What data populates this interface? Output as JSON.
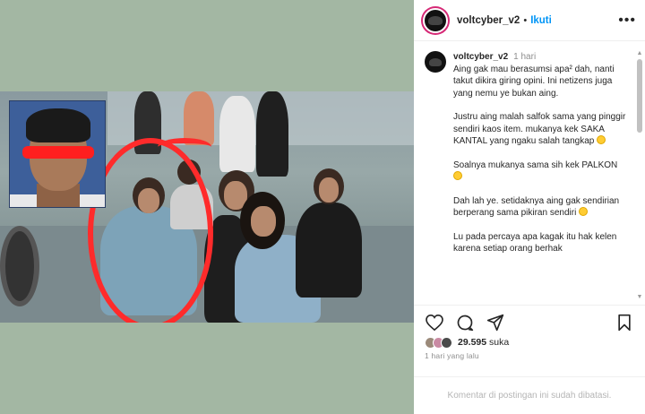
{
  "post": {
    "username": "voltcyber_v2",
    "separator": "•",
    "follow_label": "Ikuti",
    "more_label": "•••",
    "caption": {
      "username": "voltcyber_v2",
      "time": "1 hari",
      "paragraphs": [
        "Aing gak mau berasumsi apa² dah, nanti takut dikira giring opini. Ini netizens juga yang nemu ye bukan aing.",
        "Justru aing malah salfok sama yang pinggir sendiri kaos item. mukanya kek SAKA KANTAL yang ngaku salah tangkap",
        "Soalnya mukanya sama sih kek PALKON",
        "Dah lah ye. setidaknya aing gak sendirian berperang sama pikiran sendiri",
        "Lu pada percaya apa kagak itu hak kelen karena setiap orang berhak"
      ],
      "paragraph_emojis": [
        "",
        "thinking-face-emoji",
        "thinking-face-emoji",
        "",
        "pensive-face-emoji"
      ]
    },
    "likes": {
      "count": "29.595",
      "label": "suka"
    },
    "date": "1 hari yang lalu",
    "comments_closed": "Komentar di postingan ini sudah dibatasi."
  },
  "icons": {
    "like": "heart-icon",
    "comment": "comment-icon",
    "share": "share-icon",
    "save": "bookmark-icon"
  },
  "colors": {
    "follow": "#0095f6",
    "highlight_circle": "#ff2b2b",
    "censor_band": "#ff1f1f",
    "media_background": "#a3b7a3",
    "inset_background": "#3d5f9a"
  }
}
